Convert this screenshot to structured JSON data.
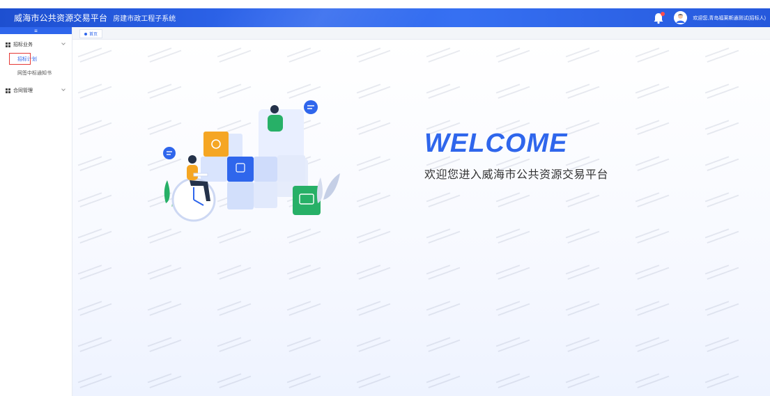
{
  "header": {
    "brand": "威海市公共资源交易平台",
    "subsystem": "房建市政工程子系统",
    "user_text": "欢迎您,青岛福莱斯通测试(招标人)",
    "icons": {
      "notify": "bell-icon",
      "user": "avatar-icon"
    }
  },
  "sidebar": {
    "toggle_icon": "≡",
    "groups": [
      {
        "label": "招标业务",
        "items": [
          {
            "label": "招标计划",
            "active": true
          },
          {
            "label": "网签中标通知书",
            "active": false
          }
        ]
      },
      {
        "label": "合同管理",
        "items": []
      }
    ]
  },
  "tabs": [
    {
      "label": "首页"
    }
  ],
  "main": {
    "welcome_title": "WELCOME",
    "welcome_subtitle": "欢迎您进入威海市公共资源交易平台"
  },
  "colors": {
    "primary": "#2f66ec",
    "highlight_box": "#e53935",
    "green_tile": "#27b067",
    "orange_tile": "#f5a623"
  }
}
